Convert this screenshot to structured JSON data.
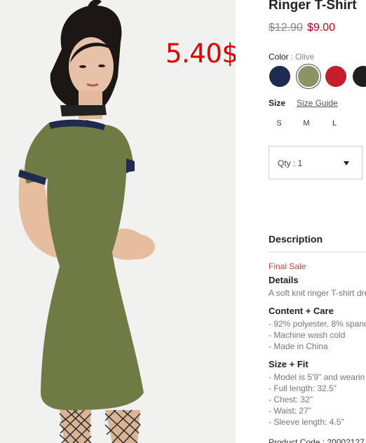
{
  "promo": {
    "overlay_price": "5.40$"
  },
  "product": {
    "title": "Ringer T-Shirt",
    "price_original": "$12.90",
    "price_sale": "$9.00"
  },
  "color": {
    "label": "Color",
    "separator": ":",
    "selected": "Olive",
    "swatches": [
      {
        "name": "Navy",
        "hex": "#1f2a4f"
      },
      {
        "name": "Olive",
        "hex": "#8d9366"
      },
      {
        "name": "Red",
        "hex": "#c41e2e"
      },
      {
        "name": "Black",
        "hex": "#1e1e1e"
      }
    ]
  },
  "size": {
    "label": "Size",
    "guide_link": "Size Guide",
    "options": [
      "S",
      "M",
      "L"
    ]
  },
  "quantity": {
    "label": "Qty : 1"
  },
  "description": {
    "heading": "Description",
    "final_sale": "Final Sale",
    "details_heading": "Details",
    "details_text": "A soft knit ringer T-shirt dre",
    "content_heading": "Content + Care",
    "content_lines": [
      "- 92% polyester, 8% spand",
      "- Machine wash cold",
      "- Made in China"
    ],
    "fit_heading": "Size + Fit",
    "fit_lines": [
      "- Model is 5'9\" and wearin",
      "- Full length: 32.5\"",
      "- Chest: 32\"",
      "- Waist: 27\"",
      "- Sleeve length: 4.5\""
    ],
    "product_code": "Product Code : 20002127"
  }
}
